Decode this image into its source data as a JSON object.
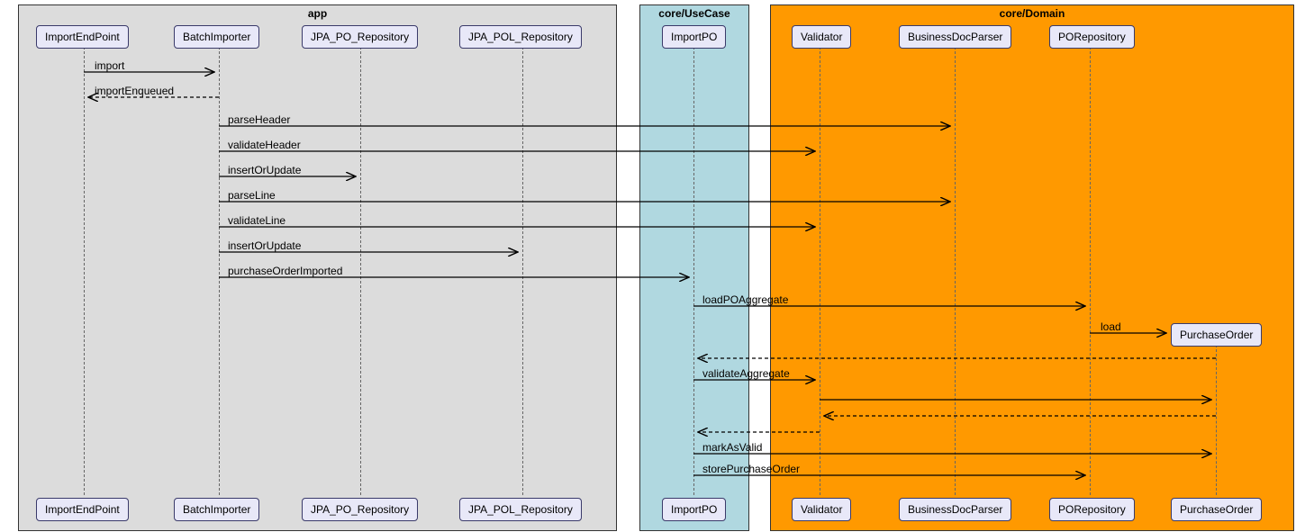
{
  "boxes": {
    "app": {
      "title": "app"
    },
    "usecase": {
      "title": "core/UseCase"
    },
    "domain": {
      "title": "core/Domain"
    }
  },
  "participants": {
    "importEndPoint": "ImportEndPoint",
    "batchImporter": "BatchImporter",
    "jpaPoRepo": "JPA_PO_Repository",
    "jpaPolRepo": "JPA_POL_Repository",
    "importPO": "ImportPO",
    "validator": "Validator",
    "businessDocParser": "BusinessDocParser",
    "poRepository": "PORepository",
    "purchaseOrder": "PurchaseOrder"
  },
  "messages": {
    "m1": "import",
    "m2": "importEnqueued",
    "m3": "parseHeader",
    "m4": "validateHeader",
    "m5": "insertOrUpdate",
    "m6": "parseLine",
    "m7": "validateLine",
    "m8": "insertOrUpdate",
    "m9": "purchaseOrderImported",
    "m10": "loadPOAggregate",
    "m11": "load",
    "m12": "validateAggregate",
    "m13": "markAsValid",
    "m14": "storePurchaseOrder"
  },
  "chart_data": {
    "type": "sequence-diagram",
    "boxes": [
      {
        "name": "app",
        "participants": [
          "ImportEndPoint",
          "BatchImporter",
          "JPA_PO_Repository",
          "JPA_POL_Repository"
        ]
      },
      {
        "name": "core/UseCase",
        "participants": [
          "ImportPO"
        ]
      },
      {
        "name": "core/Domain",
        "participants": [
          "Validator",
          "BusinessDocParser",
          "PORepository",
          "PurchaseOrder"
        ]
      }
    ],
    "messages": [
      {
        "from": "ImportEndPoint",
        "to": "BatchImporter",
        "label": "import",
        "style": "solid"
      },
      {
        "from": "BatchImporter",
        "to": "ImportEndPoint",
        "label": "importEnqueued",
        "style": "dashed"
      },
      {
        "from": "BatchImporter",
        "to": "BusinessDocParser",
        "label": "parseHeader",
        "style": "solid"
      },
      {
        "from": "BatchImporter",
        "to": "Validator",
        "label": "validateHeader",
        "style": "solid"
      },
      {
        "from": "BatchImporter",
        "to": "JPA_PO_Repository",
        "label": "insertOrUpdate",
        "style": "solid"
      },
      {
        "from": "BatchImporter",
        "to": "BusinessDocParser",
        "label": "parseLine",
        "style": "solid"
      },
      {
        "from": "BatchImporter",
        "to": "Validator",
        "label": "validateLine",
        "style": "solid"
      },
      {
        "from": "BatchImporter",
        "to": "JPA_POL_Repository",
        "label": "insertOrUpdate",
        "style": "solid"
      },
      {
        "from": "BatchImporter",
        "to": "ImportPO",
        "label": "purchaseOrderImported",
        "style": "solid"
      },
      {
        "from": "ImportPO",
        "to": "PORepository",
        "label": "loadPOAggregate",
        "style": "solid"
      },
      {
        "from": "PORepository",
        "to": "PurchaseOrder",
        "label": "load",
        "style": "solid",
        "creates": true
      },
      {
        "from": "PurchaseOrder",
        "to": "ImportPO",
        "label": "",
        "style": "dashed"
      },
      {
        "from": "ImportPO",
        "to": "Validator",
        "label": "validateAggregate",
        "style": "solid"
      },
      {
        "from": "Validator",
        "to": "PurchaseOrder",
        "label": "",
        "style": "solid"
      },
      {
        "from": "PurchaseOrder",
        "to": "Validator",
        "label": "",
        "style": "dashed"
      },
      {
        "from": "Validator",
        "to": "ImportPO",
        "label": "",
        "style": "dashed"
      },
      {
        "from": "ImportPO",
        "to": "PurchaseOrder",
        "label": "markAsValid",
        "style": "solid"
      },
      {
        "from": "ImportPO",
        "to": "PORepository",
        "label": "storePurchaseOrder",
        "style": "solid"
      }
    ]
  }
}
